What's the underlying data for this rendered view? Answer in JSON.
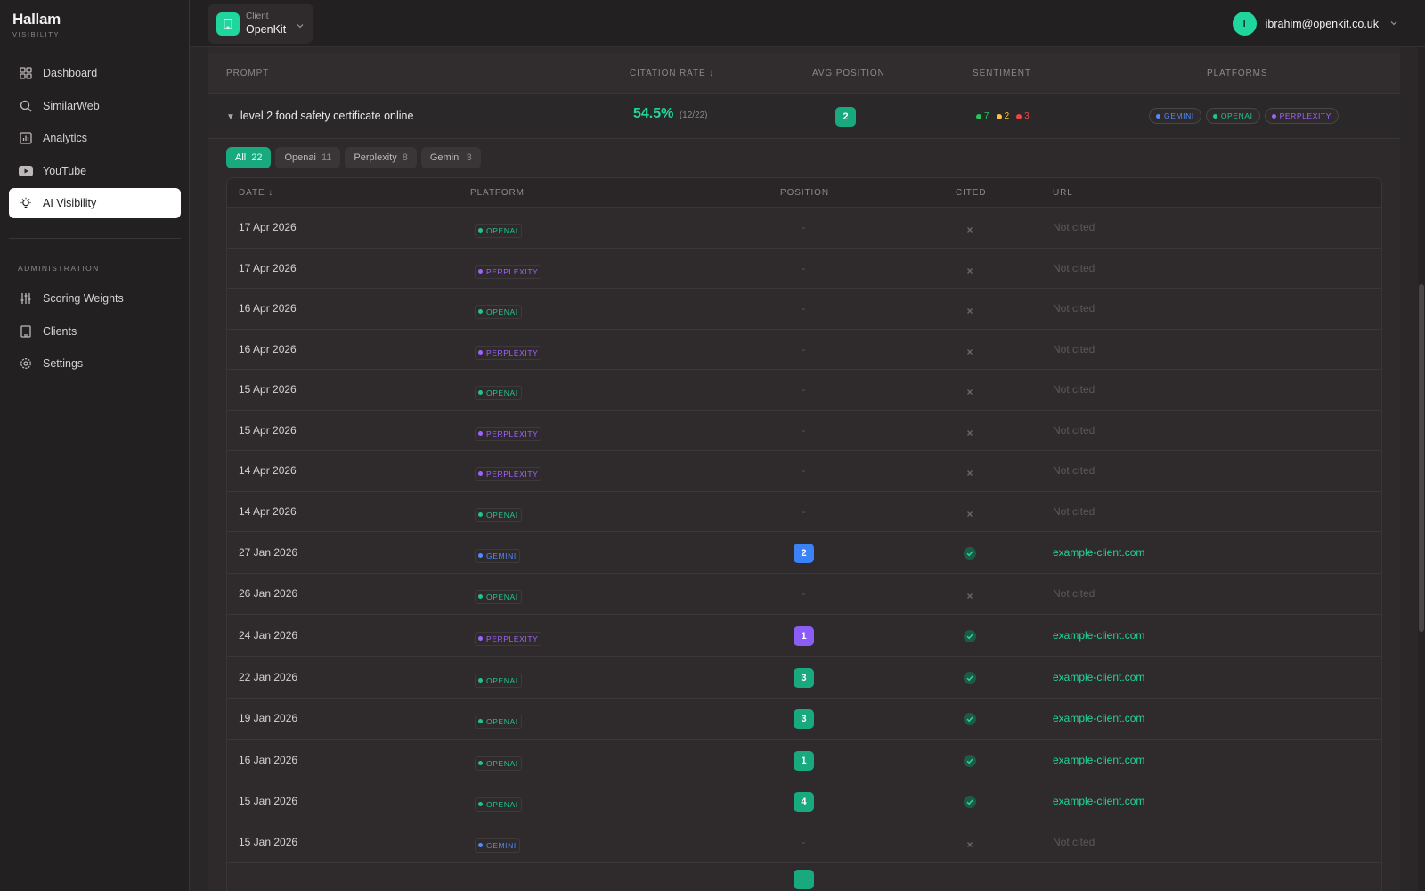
{
  "brand": {
    "name": "Hallam",
    "sub": "VISIBILITY"
  },
  "nav": {
    "items": [
      {
        "label": "Dashboard",
        "icon": "grid-icon"
      },
      {
        "label": "SimilarWeb",
        "icon": "search-icon"
      },
      {
        "label": "Analytics",
        "icon": "chart-icon"
      },
      {
        "label": "YouTube",
        "icon": "youtube-icon"
      },
      {
        "label": "AI Visibility",
        "icon": "lightbulb-icon",
        "active": true
      }
    ],
    "section": "ADMINISTRATION",
    "admin": [
      {
        "label": "Scoring Weights",
        "icon": "sliders-icon"
      },
      {
        "label": "Clients",
        "icon": "building-icon"
      },
      {
        "label": "Settings",
        "icon": "gear-icon"
      }
    ]
  },
  "topbar": {
    "client_label": "Client",
    "client_name": "OpenKit",
    "user_initial": "I",
    "user_email": "ibrahim@openkit.co.uk"
  },
  "colors": {
    "accent": "#1fd69d",
    "openai": "#22c489",
    "perplexity": "#a062ff",
    "gemini": "#4f8cff",
    "positive": "#22c55e",
    "neutral": "#f5c542",
    "negative": "#ef4444"
  },
  "header": {
    "prompt": "PROMPT",
    "citation_rate": "CITATION RATE ↓",
    "avg_position": "AVG POSITION",
    "sentiment": "SENTIMENT",
    "platforms": "PLATFORMS"
  },
  "prompt_row": {
    "text": "level 2 food safety certificate online",
    "citation_rate": "54.5%",
    "citation_detail": "(12/22)",
    "avg_position": "2",
    "sentiment": {
      "positive": "7",
      "neutral": "2",
      "negative": "3"
    },
    "platforms": [
      "GEMINI",
      "OPENAI",
      "PERPLEXITY"
    ]
  },
  "tabs": [
    {
      "label": "All",
      "count": "22",
      "active": true
    },
    {
      "label": "Openai",
      "count": "11"
    },
    {
      "label": "Perplexity",
      "count": "8"
    },
    {
      "label": "Gemini",
      "count": "3"
    }
  ],
  "table": {
    "headers": {
      "date": "DATE ↓",
      "platform": "PLATFORM",
      "position": "POSITION",
      "cited": "CITED",
      "url": "URL"
    },
    "rows": [
      {
        "date": "17 Apr 2026",
        "platform": "OPENAI",
        "position": "-",
        "cited": false,
        "url": "Not cited"
      },
      {
        "date": "17 Apr 2026",
        "platform": "PERPLEXITY",
        "position": "-",
        "cited": false,
        "url": "Not cited"
      },
      {
        "date": "16 Apr 2026",
        "platform": "OPENAI",
        "position": "-",
        "cited": false,
        "url": "Not cited"
      },
      {
        "date": "16 Apr 2026",
        "platform": "PERPLEXITY",
        "position": "-",
        "cited": false,
        "url": "Not cited"
      },
      {
        "date": "15 Apr 2026",
        "platform": "OPENAI",
        "position": "-",
        "cited": false,
        "url": "Not cited"
      },
      {
        "date": "15 Apr 2026",
        "platform": "PERPLEXITY",
        "position": "-",
        "cited": false,
        "url": "Not cited"
      },
      {
        "date": "14 Apr 2026",
        "platform": "PERPLEXITY",
        "position": "-",
        "cited": false,
        "url": "Not cited"
      },
      {
        "date": "14 Apr 2026",
        "platform": "OPENAI",
        "position": "-",
        "cited": false,
        "url": "Not cited"
      },
      {
        "date": "27 Jan 2026",
        "platform": "GEMINI",
        "position": "2",
        "cited": true,
        "url": "example-client.com"
      },
      {
        "date": "26 Jan 2026",
        "platform": "OPENAI",
        "position": "-",
        "cited": false,
        "url": "Not cited"
      },
      {
        "date": "24 Jan 2026",
        "platform": "PERPLEXITY",
        "position": "1",
        "cited": true,
        "url": "example-client.com"
      },
      {
        "date": "22 Jan 2026",
        "platform": "OPENAI",
        "position": "3",
        "cited": true,
        "url": "example-client.com"
      },
      {
        "date": "19 Jan 2026",
        "platform": "OPENAI",
        "position": "3",
        "cited": true,
        "url": "example-client.com"
      },
      {
        "date": "16 Jan 2026",
        "platform": "OPENAI",
        "position": "1",
        "cited": true,
        "url": "example-client.com"
      },
      {
        "date": "15 Jan 2026",
        "platform": "OPENAI",
        "position": "4",
        "cited": true,
        "url": "example-client.com"
      },
      {
        "date": "15 Jan 2026",
        "platform": "GEMINI",
        "position": "-",
        "cited": false,
        "url": "Not cited"
      }
    ]
  }
}
